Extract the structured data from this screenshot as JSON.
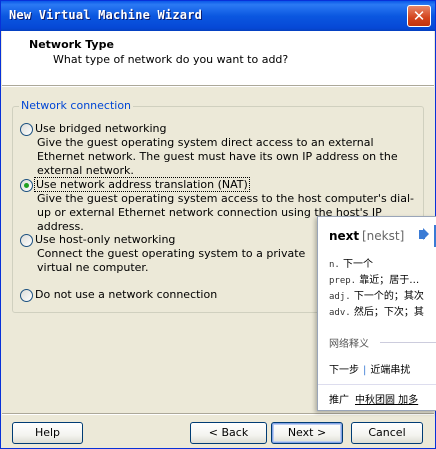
{
  "window": {
    "title": "New Virtual Machine Wizard",
    "close_glyph": "✕"
  },
  "header": {
    "title": "Network Type",
    "subtitle": "What type of network do you want to add?"
  },
  "group": {
    "legend": "Network connection",
    "options": [
      {
        "label": "Use bridged networking",
        "description": "Give the guest operating system direct access to an external Ethernet network. The guest must have its own IP address on the external network.",
        "selected": false
      },
      {
        "label": "Use network address translation (NAT)",
        "description": "Give the guest operating system access to the host computer's dial-up or external Ethernet network connection using the host's IP address.",
        "selected": true
      },
      {
        "label": "Use host-only networking",
        "description": "Connect the guest operating system to a private virtual ne computer.",
        "selected": false
      },
      {
        "label": "Do not use a network connection",
        "description": "",
        "selected": false
      }
    ]
  },
  "buttons": {
    "help": "Help",
    "back": "< Back",
    "next": "Next >",
    "cancel": "Cancel"
  },
  "dictionary": {
    "word": "next",
    "phonetic": "[nekst]",
    "speaker_icon": "speaker-icon",
    "definitions": [
      {
        "pos": "n.",
        "text": "下一个"
      },
      {
        "pos": "prep.",
        "text": "靠近；居于…"
      },
      {
        "pos": "adj.",
        "text": "下一个的；其次"
      },
      {
        "pos": "adv.",
        "text": "然后；下次；其"
      }
    ],
    "section_label": "网络释义",
    "web_terms": [
      "下一步",
      "近端串扰"
    ],
    "ad_label": "推广",
    "ad_link": "中秋团圆 加多"
  },
  "colors": {
    "titlebar": "#0b57e0",
    "dialog_bg": "#ece9d8",
    "legend": "#0046d5",
    "radio_dot": "#21a121"
  }
}
